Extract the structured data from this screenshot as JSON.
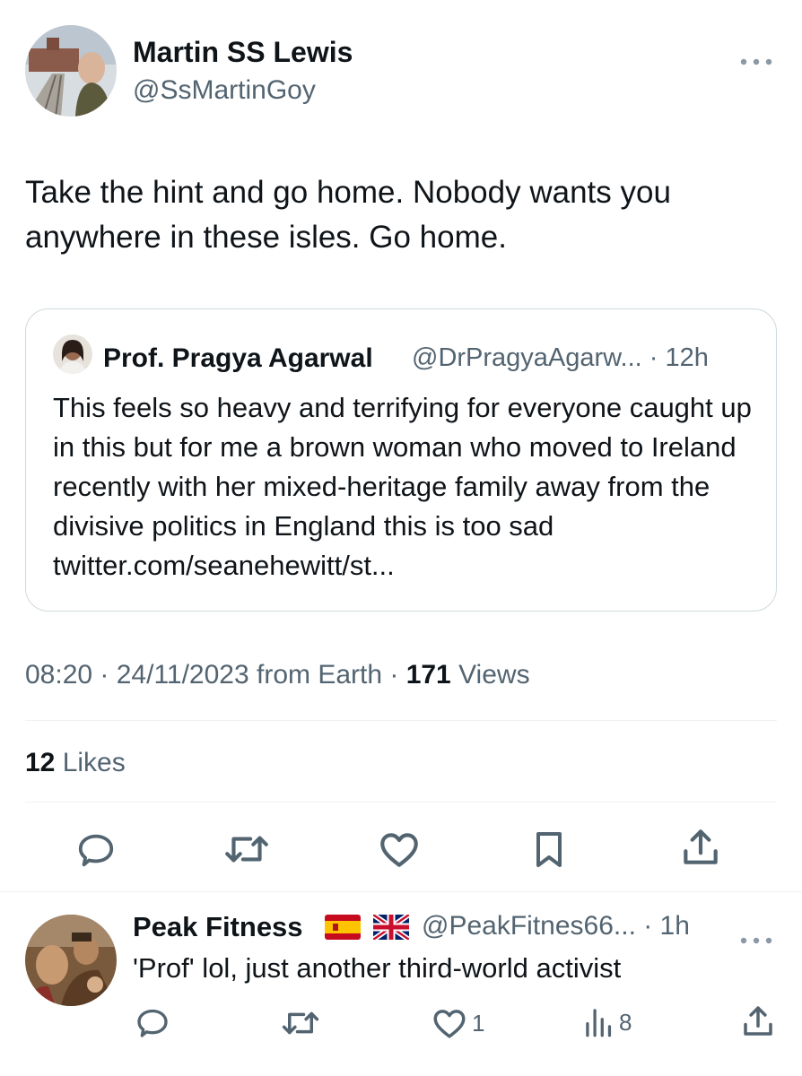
{
  "tweet": {
    "author_name": "Martin SS Lewis",
    "author_handle": "@SsMartinGoy",
    "more_icon": "more-horizontal-icon",
    "text": "Take the hint and go home. Nobody wants you anywhere in these isles. Go home.",
    "quote": {
      "author_name": "Prof. Pragya Agarwal",
      "meta": "@DrPragyaAgarw... · 12h",
      "text": "This feels so heavy and terrifying for everyone caught up in this but for me a brown woman who moved to Ireland recently with her mixed-heritage family away from the divisive politics in England this is too sad twitter.com/seanehewitt/st..."
    },
    "timestamp": "08:20 · 24/11/2023 from Earth · ",
    "views_count": "171",
    "views_label": " Views",
    "likes_count": "12",
    "likes_label": " Likes",
    "actions": [
      "reply-icon",
      "retweet-icon",
      "like-icon",
      "bookmark-icon",
      "share-icon"
    ]
  },
  "reply": {
    "author_name": "Peak Fitness",
    "flags": [
      "spain-flag-icon",
      "uk-flag-icon"
    ],
    "meta": "@PeakFitnes66... · 1h",
    "text": "'Prof' lol, just another third-world activist",
    "like_count": "1",
    "views_count": "8"
  },
  "colors": {
    "text": "#0f1419",
    "secondary": "#536471",
    "border": "#cfd9de",
    "divider": "#eff3f4"
  }
}
